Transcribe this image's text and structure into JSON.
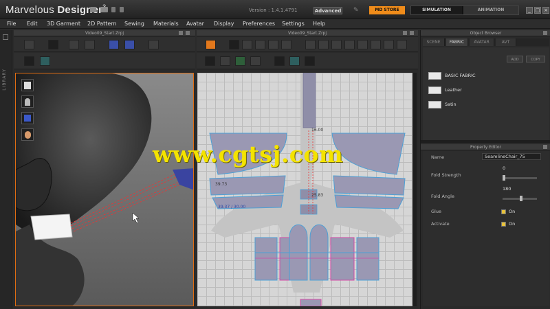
{
  "app": {
    "name_light": "Marvelous",
    "name_bold": " Designer",
    "version_major": "3",
    "version": "Version : 1.4.1.4791",
    "edition": "Advanced",
    "store_label": "MD STORE",
    "simulation_label": "SIMULATION",
    "animation_label": "ANIMATION",
    "minimize": "_",
    "maximize": "□",
    "close": "×"
  },
  "menu": [
    "File",
    "Edit",
    "3D Garment",
    "2D Pattern",
    "Sewing",
    "Materials",
    "Avatar",
    "Display",
    "Preferences",
    "Settings",
    "Help"
  ],
  "library_label": "LIBRARY",
  "view3d": {
    "title": "Video09_Start.Zrpj"
  },
  "view2d": {
    "title": "Video09_Start.Zrpj",
    "measurements": [
      "16.00",
      "39.73",
      "25.83",
      "39.37 / 30.00"
    ]
  },
  "watermark": "www.cgtsj.com",
  "object_browser": {
    "title": "Object Browser",
    "tabs": [
      "SCENE",
      "FABRIC",
      "AVATAR",
      "AVT"
    ],
    "active_tab": 1,
    "add_label": "ADD",
    "copy_label": "COPY",
    "fabrics": [
      "BASIC FABRIC",
      "Leather",
      "Satin"
    ]
  },
  "property_editor": {
    "title": "Property Editor",
    "name_label": "Name",
    "name_value": "SeamlineChair_75",
    "fold_strength_label": "Fold Strength",
    "fold_strength_value": "0",
    "fold_angle_label": "Fold Angle",
    "fold_angle_value": "180",
    "glue_label": "Glue",
    "glue_value": "On",
    "activate_label": "Activate",
    "activate_value": "On"
  },
  "colors": {
    "accent": "#f08c1a",
    "selection_border": "#e06d12",
    "pattern": "#9a98b3",
    "grid_bg": "#d6d6d6"
  }
}
